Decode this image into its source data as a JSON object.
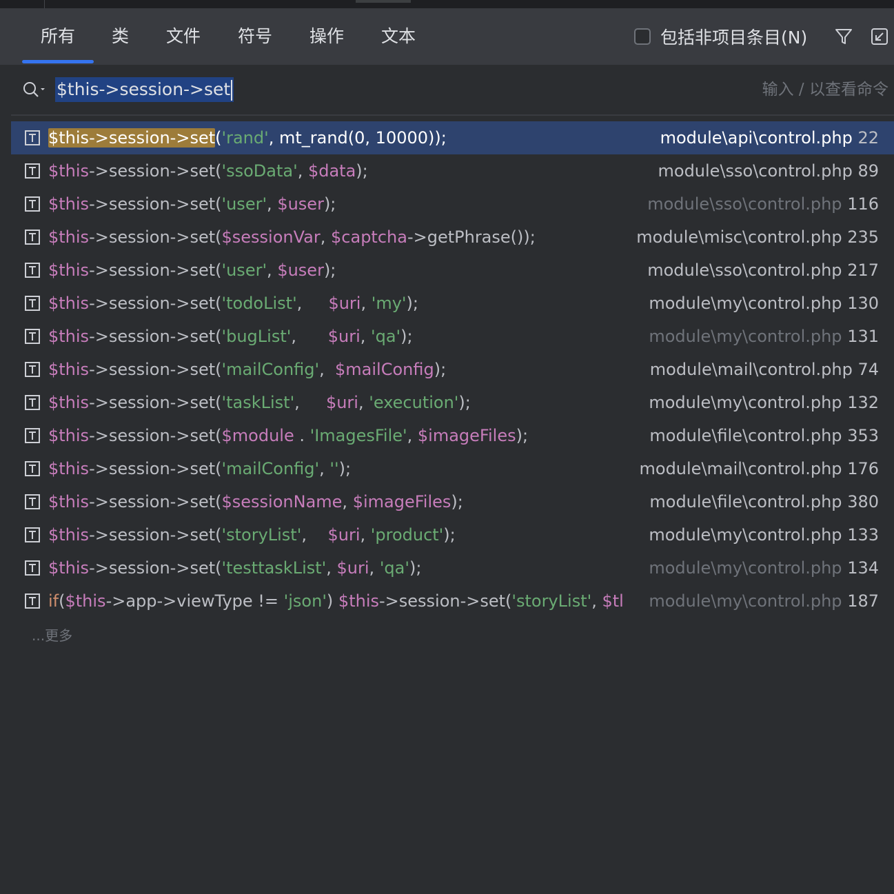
{
  "tabs": [
    "所有",
    "类",
    "文件",
    "符号",
    "操作",
    "文本"
  ],
  "include_label": "包括非项目条目(N)",
  "search": {
    "query": "$this->session->set",
    "hint": "输入 / 以查看命令"
  },
  "query_prefix": "$this->session->set",
  "results": [
    {
      "rest": "('rand', mt_rand(0, 10000));",
      "file": "module\\api\\control.php",
      "line": "22"
    },
    {
      "rest": "('ssoData', $data);",
      "file": "module\\sso\\control.php",
      "line": "89"
    },
    {
      "rest": "('user', $user);",
      "file": "module\\sso\\control.php",
      "line": "116"
    },
    {
      "rest": "($sessionVar, $captcha->getPhrase());",
      "file": "module\\misc\\control.php",
      "line": "235"
    },
    {
      "rest": "('user', $user);",
      "file": "module\\sso\\control.php",
      "line": "217"
    },
    {
      "rest": "('todoList',     $uri, 'my');",
      "file": "module\\my\\control.php",
      "line": "130"
    },
    {
      "rest": "('bugList',      $uri, 'qa');",
      "file": "module\\my\\control.php",
      "line": "131"
    },
    {
      "rest": "('mailConfig',  $mailConfig);",
      "file": "module\\mail\\control.php",
      "line": "74"
    },
    {
      "rest": "('taskList',     $uri, 'execution');",
      "file": "module\\my\\control.php",
      "line": "132"
    },
    {
      "rest": "($module . 'ImagesFile', $imageFiles);",
      "file": "module\\file\\control.php",
      "line": "353"
    },
    {
      "rest": "('mailConfig', '');",
      "file": "module\\mail\\control.php",
      "line": "176"
    },
    {
      "rest": "($sessionName, $imageFiles);",
      "file": "module\\file\\control.php",
      "line": "380"
    },
    {
      "rest": "('storyList',    $uri, 'product');",
      "file": "module\\my\\control.php",
      "line": "133"
    },
    {
      "rest": "('testtaskList', $uri, 'qa');",
      "file": "module\\my\\control.php",
      "line": "134"
    },
    {
      "code": "if($this->app->viewType != 'json') $this->session->set('storyList', $tl",
      "file": "module\\my\\control.php",
      "line": "187"
    }
  ],
  "more_label": "...更多"
}
